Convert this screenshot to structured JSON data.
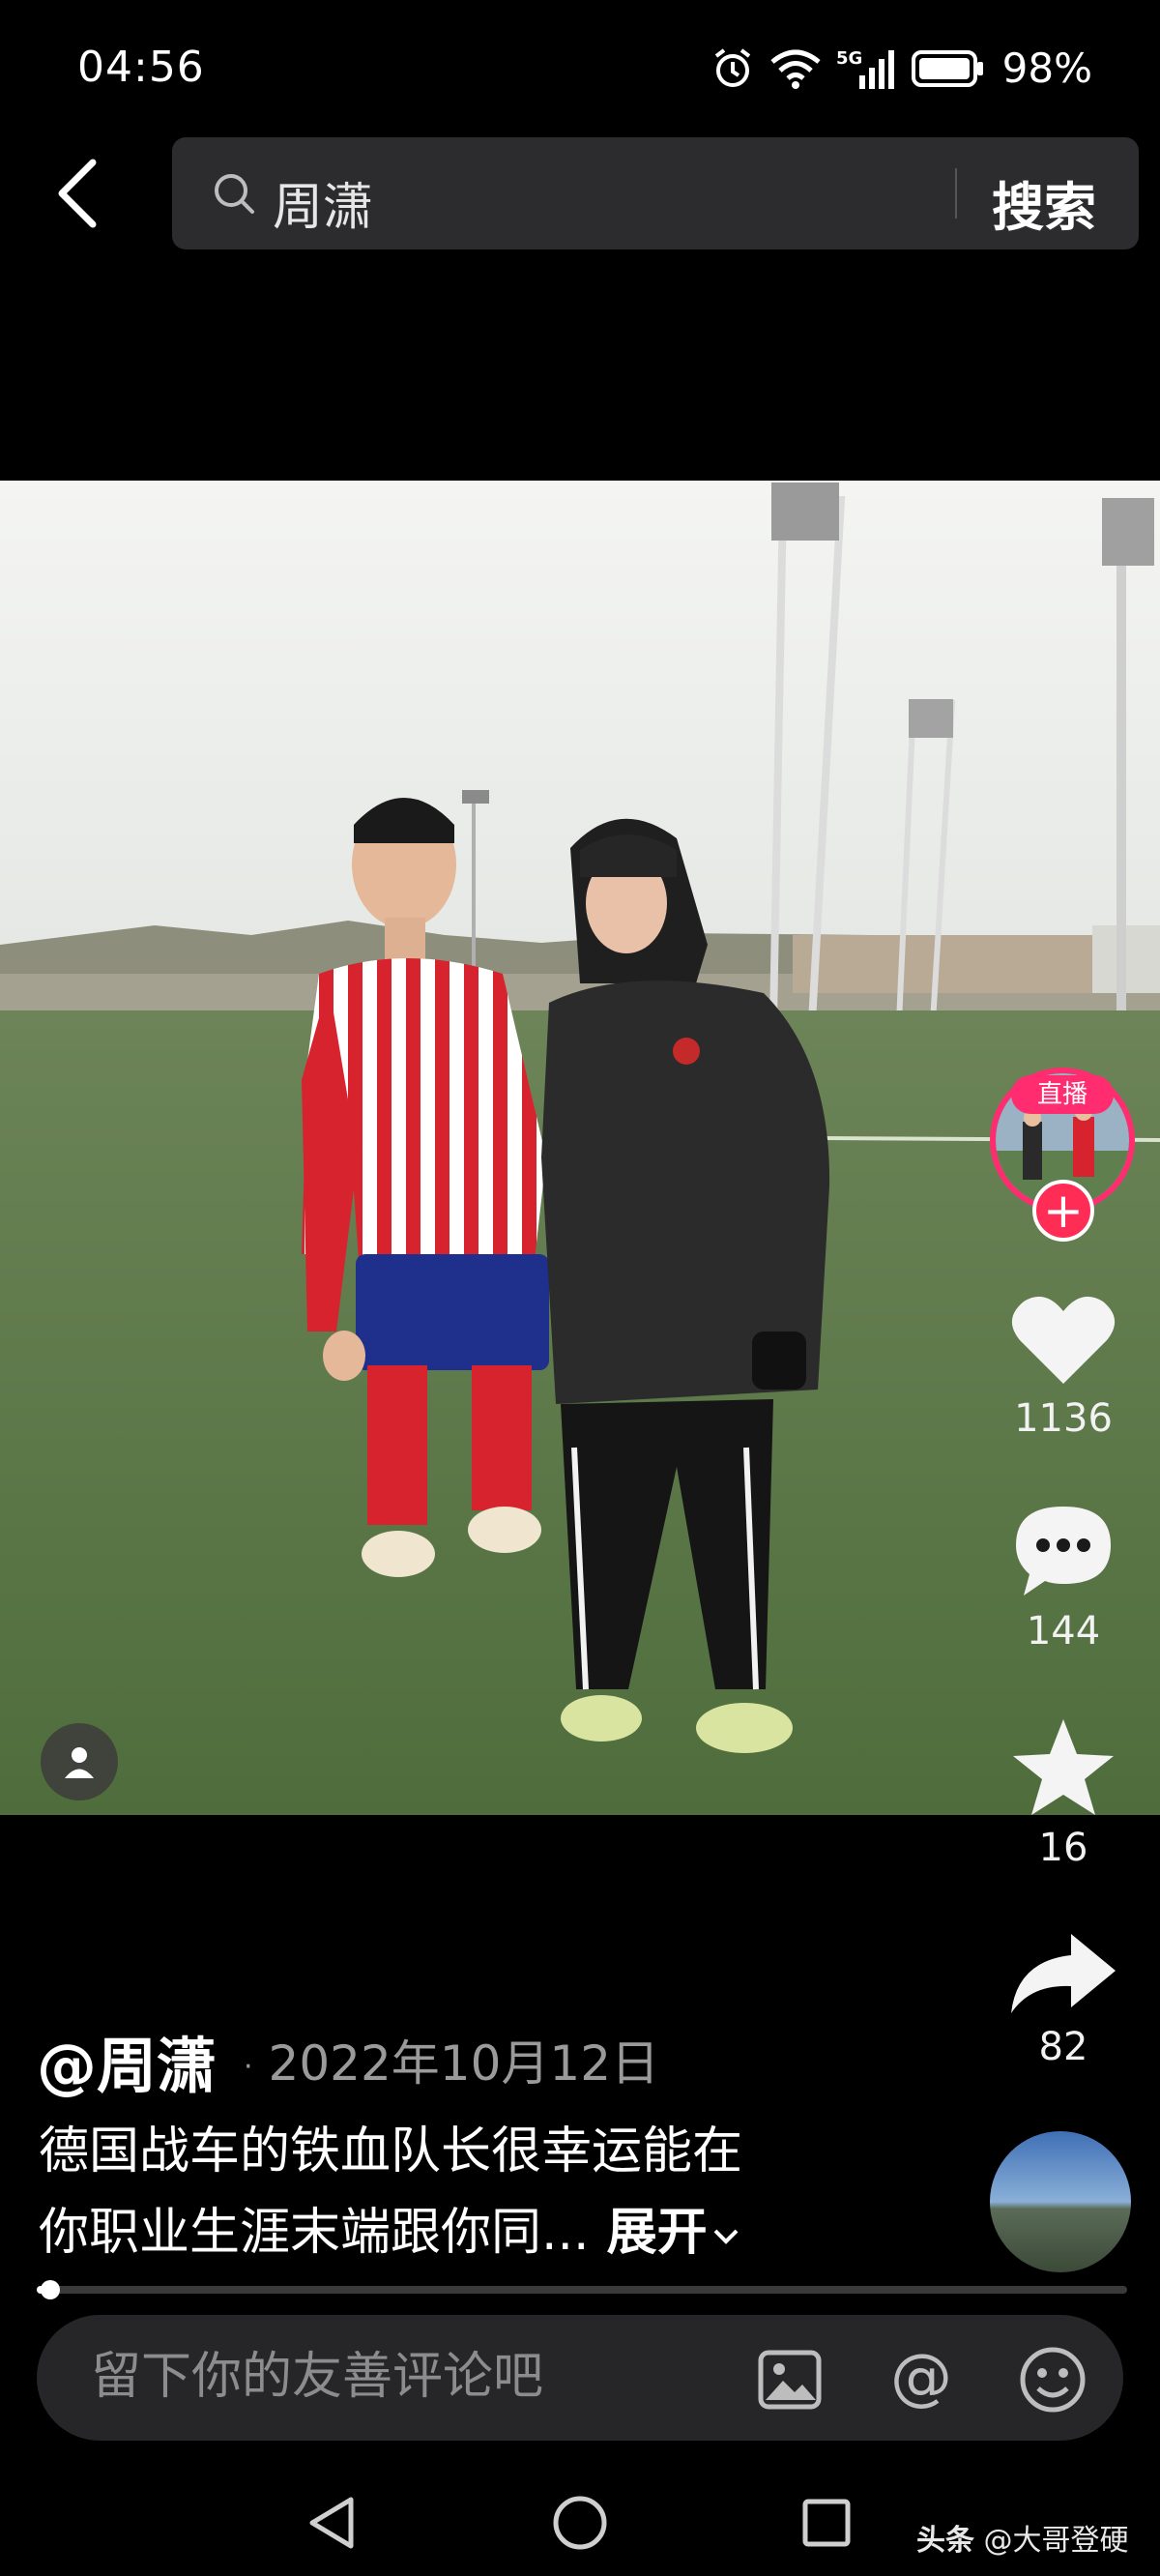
{
  "status_bar": {
    "time": "04:56",
    "network": "5G",
    "battery": "98%",
    "icons": [
      "alarm-icon",
      "wifi-icon",
      "signal-icon",
      "battery-icon"
    ]
  },
  "search": {
    "query": "周潇",
    "submit_label": "搜索"
  },
  "side_actions": {
    "live_label": "直播",
    "follow_symbol": "+",
    "like_count": "1136",
    "comment_count": "144",
    "favorite_count": "16",
    "share_count": "82"
  },
  "post": {
    "author": "@周潇",
    "date": "2022年10月12日",
    "date_separator": "·",
    "description_line1": "德国战车的铁血队长很幸运能在",
    "description_line2": "你职业生涯末端跟你同...",
    "expand_label": "展开",
    "progress": 0.02
  },
  "comment": {
    "placeholder": "留下你的友善评论吧"
  },
  "watermark": {
    "brand": "头条",
    "handle": "@大哥登硬"
  },
  "colors": {
    "background": "#000000",
    "accent": "#ff2d55",
    "muted_text": "#9a9a9a"
  }
}
